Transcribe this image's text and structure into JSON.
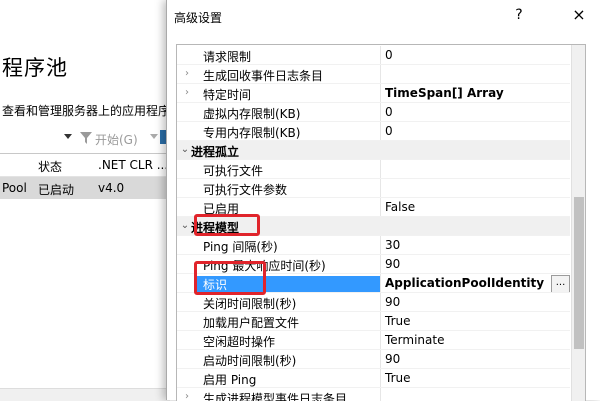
{
  "background_window": {
    "title": "程序池",
    "description": "查看和管理服务器上的应用程序",
    "toolbar": {
      "start_label": "开始(G)"
    },
    "columns": {
      "status": "状态",
      "clr": ".NET CLR ..."
    },
    "row": {
      "name": "Pool",
      "status": "已启动",
      "clr": "v4.0"
    }
  },
  "dialog": {
    "title": "高级设置",
    "help": "?",
    "close": "×",
    "rows": [
      {
        "type": "prop",
        "name": "请求限制",
        "value": "0",
        "expander": ""
      },
      {
        "type": "prop",
        "name": "生成回收事件日志条目",
        "value": "",
        "expander": "›"
      },
      {
        "type": "prop",
        "name": "特定时间",
        "value": "TimeSpan[] Array",
        "expander": "›",
        "bold": true
      },
      {
        "type": "prop",
        "name": "虚拟内存限制(KB)",
        "value": "0",
        "expander": ""
      },
      {
        "type": "prop",
        "name": "专用内存限制(KB)",
        "value": "0",
        "expander": ""
      },
      {
        "type": "cat",
        "name": "进程孤立",
        "value": "",
        "expander": "⌄"
      },
      {
        "type": "prop",
        "name": "可执行文件",
        "value": "",
        "expander": ""
      },
      {
        "type": "prop",
        "name": "可执行文件参数",
        "value": "",
        "expander": ""
      },
      {
        "type": "prop",
        "name": "已启用",
        "value": "False",
        "expander": ""
      },
      {
        "type": "cat",
        "name": "进程模型",
        "value": "",
        "expander": "⌄"
      },
      {
        "type": "prop",
        "name": "Ping 间隔(秒)",
        "value": "30",
        "expander": ""
      },
      {
        "type": "prop",
        "name": "Ping 最大响应时间(秒)",
        "value": "90",
        "expander": ""
      },
      {
        "type": "sel",
        "name": "标识",
        "value": "ApplicationPoolIdentity",
        "expander": ""
      },
      {
        "type": "prop",
        "name": "关闭时间限制(秒)",
        "value": "90",
        "expander": ""
      },
      {
        "type": "prop",
        "name": "加载用户配置文件",
        "value": "True",
        "expander": ""
      },
      {
        "type": "prop",
        "name": "空闲超时操作",
        "value": "Terminate",
        "expander": ""
      },
      {
        "type": "prop",
        "name": "启动时间限制(秒)",
        "value": "90",
        "expander": ""
      },
      {
        "type": "prop",
        "name": "启用 Ping",
        "value": "True",
        "expander": ""
      },
      {
        "type": "prop",
        "name": "生成进程模型事件日志条目",
        "value": "",
        "expander": "›"
      }
    ],
    "ellipsis": "..."
  },
  "colors": {
    "selection": "#3399ff",
    "highlight": "#e0242b"
  }
}
